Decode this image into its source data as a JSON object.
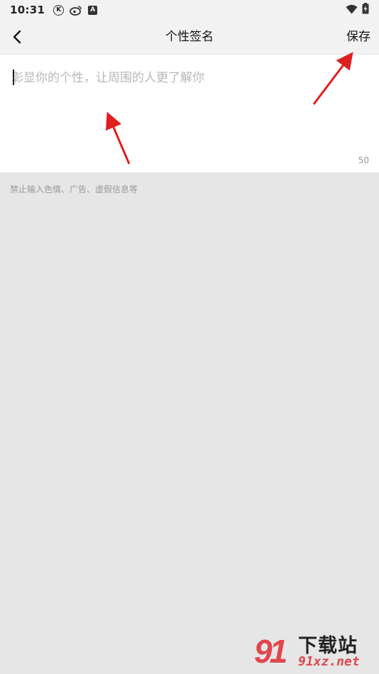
{
  "status_bar": {
    "time": "10:31",
    "left_icons": [
      "k-circle-icon",
      "weibo-icon",
      "a-box-icon"
    ],
    "k_glyph": "K",
    "a_glyph": "A",
    "right_icons": [
      "wifi-icon",
      "battery-charging-icon"
    ]
  },
  "header": {
    "title": "个性签名",
    "save_label": "保存",
    "back_icon": "chevron-left-icon"
  },
  "signature": {
    "placeholder": "彰显你的个性，让周围的人更了解你",
    "value": "",
    "max_length": "50"
  },
  "hint": "禁止输入色情、广告、虚假信息等",
  "watermark": {
    "badge": "91",
    "top_text": "下载站",
    "bottom_text": "91xz.net"
  },
  "colors": {
    "background": "#e6e6e6",
    "header": "#f2f2f2",
    "card": "#ffffff",
    "annotation_arrow": "#e02020",
    "watermark_red": "#e2464c"
  }
}
